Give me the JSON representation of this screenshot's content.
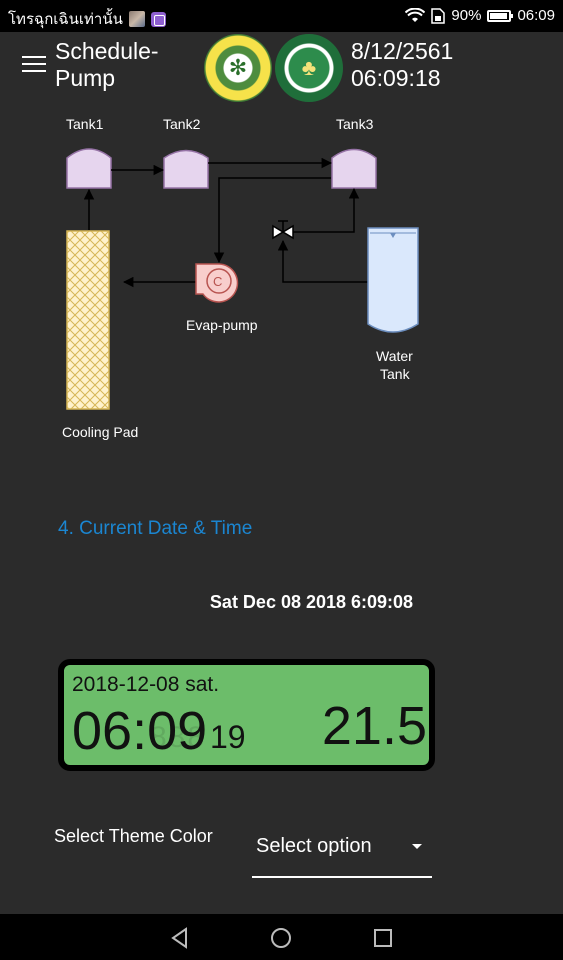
{
  "status_bar": {
    "carrier": "โทรฉุกเฉินเท่านั้น",
    "battery": "90%",
    "time": "06:09"
  },
  "header": {
    "title": "Schedule-Pump",
    "date": "8/12/2561",
    "time": "06:09:18"
  },
  "diagram": {
    "tank1": "Tank1",
    "tank2": "Tank2",
    "tank3": "Tank3",
    "pump": "Evap-pump",
    "pump_symbol": "C",
    "water_tank_line1": "Water",
    "water_tank_line2": "Tank",
    "cooling_pad": "Cooling Pad"
  },
  "section": {
    "heading": "4. Current Date & Time",
    "date_line": "Sat Dec 08 2018 6:09:08"
  },
  "lcd": {
    "date": "2018-12-08 sat.",
    "time": "06:09",
    "seconds": "19",
    "temperature": "21.5"
  },
  "theme": {
    "label": "Select Theme Color",
    "selected": "Select option"
  },
  "colors": {
    "heading": "#1b86d1",
    "lcd_background": "#6cbd6a",
    "tank_fill": "#e6d5ee",
    "pump_fill": "#f8cecc",
    "cooling_pad_fill": "#fff2cc",
    "water_tank_fill": "#dae8fc"
  },
  "icons": {
    "menu": "hamburger-icon",
    "wifi": "wifi-icon",
    "battery": "battery-icon",
    "back": "back-triangle-icon",
    "home": "home-circle-icon",
    "recent": "recent-square-icon"
  }
}
